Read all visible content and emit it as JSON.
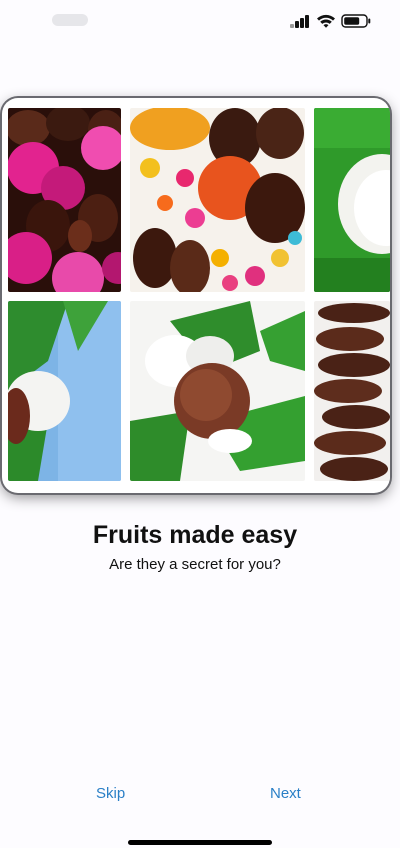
{
  "onboarding": {
    "title": "Fruits made easy",
    "subtitle": "Are they a secret for you?"
  },
  "footer": {
    "skip_label": "Skip",
    "next_label": "Next"
  },
  "colors": {
    "accent": "#2a7fc6",
    "background": "#fdfcff",
    "title_text": "#111111"
  },
  "icons": [
    "signal-icon",
    "wifi-icon",
    "battery-icon"
  ]
}
